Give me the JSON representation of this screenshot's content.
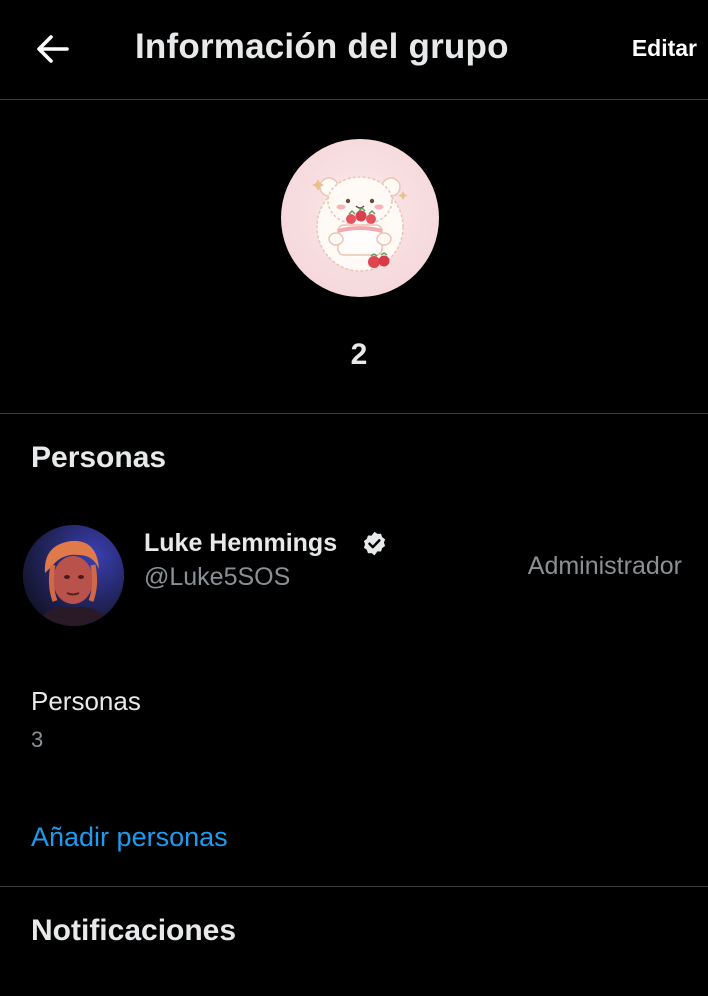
{
  "header": {
    "back_icon": "arrow-left-icon",
    "title": "Información del grupo",
    "edit_label": "Editar"
  },
  "group": {
    "name": "2"
  },
  "people_section": {
    "title": "Personas",
    "members": [
      {
        "name": "Luke Hemmings",
        "handle": "@Luke5SOS",
        "role": "Administrador",
        "verified": true
      }
    ],
    "count_label": "Personas",
    "count_value": "3",
    "add_label": "Añadir personas"
  },
  "notifications_section": {
    "title": "Notificaciones"
  },
  "colors": {
    "background": "#000000",
    "text": "#e7e9ea",
    "secondary_text": "#8b9095",
    "link": "#1d9bf0",
    "divider": "#3a3d40"
  }
}
